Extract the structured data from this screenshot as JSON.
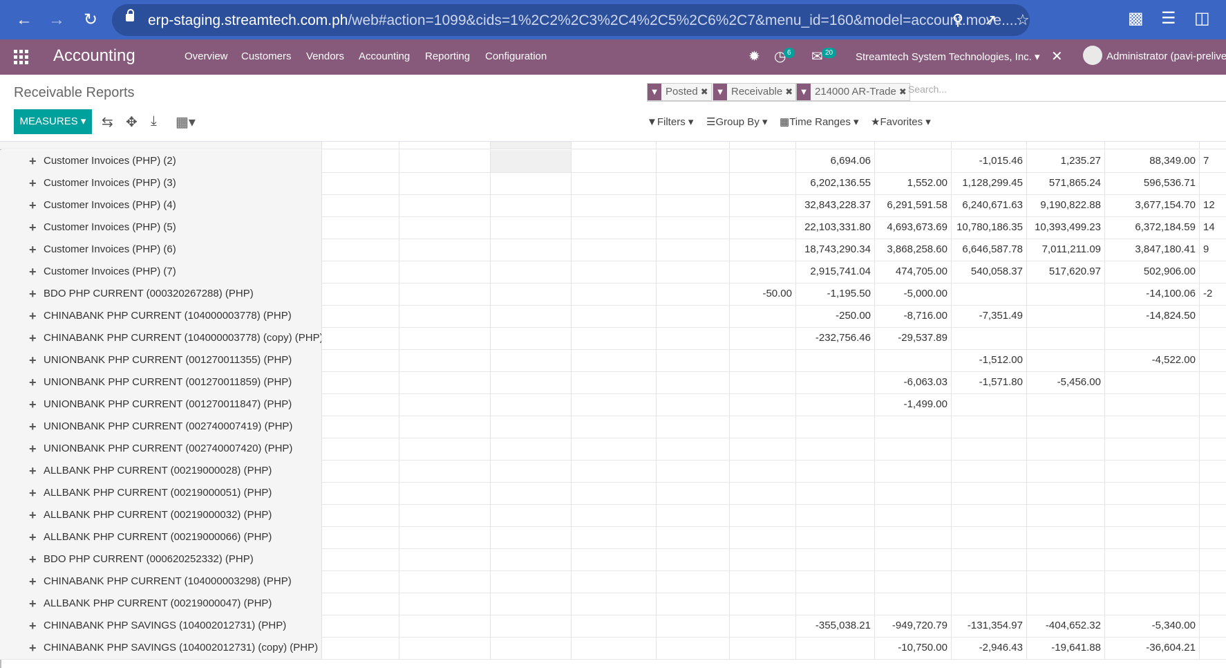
{
  "browser": {
    "url_host": "erp-staging.streamtech.com.ph",
    "url_path": "/web#action=1099&cids=1%2C2%2C3%2C4%2C5%2C6%2C7&menu_id=160&model=account.move...."
  },
  "navbar": {
    "brand": "Accounting",
    "menu": [
      "Overview",
      "Customers",
      "Vendors",
      "Accounting",
      "Reporting",
      "Configuration"
    ],
    "activity_count": "6",
    "message_count": "20",
    "company": "Streamtech System Technologies, Inc.",
    "user": "Administrator (pavi-prelive-"
  },
  "control": {
    "title": "Receivable Reports",
    "facets": [
      "Posted",
      "Receivable",
      "214000 AR-Trade"
    ],
    "search_placeholder": "Search...",
    "measures": "MEASURES",
    "filters": "Filters",
    "group_by": "Group By",
    "time_ranges": "Time Ranges",
    "favorites": "Favorites"
  },
  "rows": [
    {
      "label": "Customer Invoices (PHP) (2)",
      "values": [
        "",
        "",
        "",
        "",
        "",
        "",
        "6,694.06",
        "",
        "-1,015.46",
        "1,235.27",
        "88,349.00",
        "7"
      ]
    },
    {
      "label": "Customer Invoices (PHP) (3)",
      "values": [
        "",
        "",
        "",
        "",
        "",
        "",
        "6,202,136.55",
        "1,552.00",
        "1,128,299.45",
        "571,865.24",
        "596,536.71",
        ""
      ]
    },
    {
      "label": "Customer Invoices (PHP) (4)",
      "values": [
        "",
        "",
        "",
        "",
        "",
        "",
        "32,843,228.37",
        "6,291,591.58",
        "6,240,671.63",
        "9,190,822.88",
        "3,677,154.70",
        "12"
      ]
    },
    {
      "label": "Customer Invoices (PHP) (5)",
      "values": [
        "",
        "",
        "",
        "",
        "",
        "",
        "22,103,331.80",
        "4,693,673.69",
        "10,780,186.35",
        "10,393,499.23",
        "6,372,184.59",
        "14"
      ]
    },
    {
      "label": "Customer Invoices (PHP) (6)",
      "values": [
        "",
        "",
        "",
        "",
        "",
        "",
        "18,743,290.34",
        "3,868,258.60",
        "6,646,587.78",
        "7,011,211.09",
        "3,847,180.41",
        "9"
      ]
    },
    {
      "label": "Customer Invoices (PHP) (7)",
      "values": [
        "",
        "",
        "",
        "",
        "",
        "",
        "2,915,741.04",
        "474,705.00",
        "540,058.37",
        "517,620.97",
        "502,906.00",
        ""
      ]
    },
    {
      "label": "BDO PHP CURRENT (000320267288) (PHP)",
      "values": [
        "",
        "",
        "",
        "",
        "",
        "-50.00",
        "-1,195.50",
        "-5,000.00",
        "",
        "",
        "-14,100.06",
        "-2"
      ]
    },
    {
      "label": "CHINABANK PHP CURRENT (104000003778) (PHP)",
      "values": [
        "",
        "",
        "",
        "",
        "",
        "",
        "-250.00",
        "-8,716.00",
        "-7,351.49",
        "",
        "-14,824.50",
        ""
      ]
    },
    {
      "label": "CHINABANK PHP CURRENT (104000003778) (copy) (PHP)",
      "values": [
        "",
        "",
        "",
        "",
        "",
        "",
        "-232,756.46",
        "-29,537.89",
        "",
        "",
        "",
        ""
      ]
    },
    {
      "label": "UNIONBANK PHP CURRENT (001270011355) (PHP)",
      "values": [
        "",
        "",
        "",
        "",
        "",
        "",
        "",
        "",
        "-1,512.00",
        "",
        "-4,522.00",
        ""
      ]
    },
    {
      "label": "UNIONBANK PHP CURRENT (001270011859) (PHP)",
      "values": [
        "",
        "",
        "",
        "",
        "",
        "",
        "",
        "-6,063.03",
        "-1,571.80",
        "-5,456.00",
        "",
        ""
      ]
    },
    {
      "label": "UNIONBANK PHP CURRENT (001270011847) (PHP)",
      "values": [
        "",
        "",
        "",
        "",
        "",
        "",
        "",
        "-1,499.00",
        "",
        "",
        "",
        ""
      ]
    },
    {
      "label": "UNIONBANK PHP CURRENT (002740007419) (PHP)",
      "values": [
        "",
        "",
        "",
        "",
        "",
        "",
        "",
        "",
        "",
        "",
        "",
        ""
      ]
    },
    {
      "label": "UNIONBANK PHP CURRENT (002740007420) (PHP)",
      "values": [
        "",
        "",
        "",
        "",
        "",
        "",
        "",
        "",
        "",
        "",
        "",
        ""
      ]
    },
    {
      "label": "ALLBANK PHP CURRENT (00219000028) (PHP)",
      "values": [
        "",
        "",
        "",
        "",
        "",
        "",
        "",
        "",
        "",
        "",
        "",
        ""
      ]
    },
    {
      "label": "ALLBANK PHP CURRENT (00219000051) (PHP)",
      "values": [
        "",
        "",
        "",
        "",
        "",
        "",
        "",
        "",
        "",
        "",
        "",
        ""
      ]
    },
    {
      "label": "ALLBANK PHP CURRENT (00219000032) (PHP)",
      "values": [
        "",
        "",
        "",
        "",
        "",
        "",
        "",
        "",
        "",
        "",
        "",
        ""
      ]
    },
    {
      "label": "ALLBANK PHP CURRENT (00219000066) (PHP)",
      "values": [
        "",
        "",
        "",
        "",
        "",
        "",
        "",
        "",
        "",
        "",
        "",
        ""
      ]
    },
    {
      "label": "BDO PHP CURRENT (000620252332) (PHP)",
      "values": [
        "",
        "",
        "",
        "",
        "",
        "",
        "",
        "",
        "",
        "",
        "",
        ""
      ]
    },
    {
      "label": "CHINABANK PHP CURRENT (104000003298) (PHP)",
      "values": [
        "",
        "",
        "",
        "",
        "",
        "",
        "",
        "",
        "",
        "",
        "",
        ""
      ]
    },
    {
      "label": "ALLBANK PHP CURRENT (00219000047) (PHP)",
      "values": [
        "",
        "",
        "",
        "",
        "",
        "",
        "",
        "",
        "",
        "",
        "",
        ""
      ]
    },
    {
      "label": "CHINABANK PHP SAVINGS (104002012731) (PHP)",
      "values": [
        "",
        "",
        "",
        "",
        "",
        "",
        "-355,038.21",
        "-949,720.79",
        "-131,354.97",
        "-404,652.32",
        "-5,340.00",
        ""
      ]
    },
    {
      "label": "CHINABANK PHP SAVINGS (104002012731) (copy) (PHP)",
      "values": [
        "",
        "",
        "",
        "",
        "",
        "",
        "",
        "-10,750.00",
        "-2,946.43",
        "-19,641.88",
        "-36,604.21",
        ""
      ]
    }
  ]
}
